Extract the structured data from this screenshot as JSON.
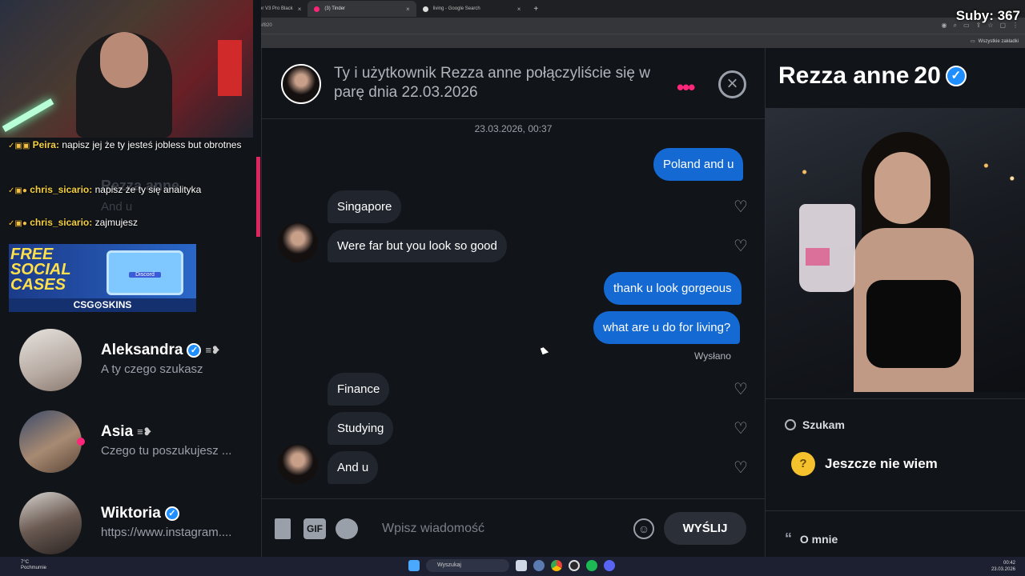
{
  "browser": {
    "tabs": [
      {
        "label": "er V3 Pro Black",
        "active": false
      },
      {
        "label": "(3) Tinder",
        "active": true
      },
      {
        "label": "living - Google Search",
        "active": false
      }
    ],
    "url_fragment": "17ef820",
    "bookmarks_label": "Wszystkie zakładki"
  },
  "overlay": {
    "subs": "Suby: 367"
  },
  "stream_chat": [
    {
      "nick": "Peira:",
      "text": "napisz jej że ty jesteś jobless but obrotnes"
    },
    {
      "nick": "chris_sicario:",
      "text": "napisz że ty się analityka"
    },
    {
      "nick": "chris_sicario:",
      "text": "zajmujesz"
    }
  ],
  "ghost_text": {
    "name": "Rezza anne",
    "msg": "And u"
  },
  "promo": {
    "headline_line1": "FREE",
    "headline_line2": "SOCIAL",
    "headline_line3": "CASES",
    "case_label": "Discord",
    "brand": "CSG⊙SKINS"
  },
  "matches": [
    {
      "name": "Aleksandra",
      "verified": true,
      "message": "A ty czego szukasz",
      "unread": false
    },
    {
      "name": "Asia",
      "verified": false,
      "message": "Czego tu poszukujesz ...",
      "unread": true
    },
    {
      "name": "Wiktoria",
      "verified": true,
      "message": "https://www.instagram....",
      "unread": false
    }
  ],
  "conversation": {
    "header": "Ty i użytkownik Rezza anne połączyliście się w parę dnia 22.03.2026",
    "timestamp": "23.03.2026, 00:37",
    "messages": [
      {
        "dir": "out",
        "text": "Poland and u"
      },
      {
        "dir": "in",
        "text": "Singapore"
      },
      {
        "dir": "in",
        "text": "Were far but you look so good"
      },
      {
        "dir": "out",
        "text": "thank u look gorgeous"
      },
      {
        "dir": "out",
        "text": "what are u do for living?"
      },
      {
        "dir": "in",
        "text": "Finance"
      },
      {
        "dir": "in",
        "text": "Studying"
      },
      {
        "dir": "in",
        "text": "And u"
      }
    ],
    "sent_label": "Wysłano",
    "composer": {
      "gif_label": "GIF",
      "placeholder": "Wpisz wiadomość",
      "send_label": "WYŚLIJ"
    }
  },
  "profile": {
    "name": "Rezza anne",
    "age": "20",
    "verified": true,
    "looking_for_label": "Szukam",
    "looking_for_value": "Jeszcze nie wiem",
    "about_label": "O mnie"
  },
  "taskbar": {
    "weather_temp": "7°C",
    "weather_desc": "Pochmurnie",
    "search_placeholder": "Wyszukaj",
    "time": "00:42",
    "date": "23.03.2026"
  },
  "colors": {
    "tinder_pink": "#fd267a",
    "bubble_out": "#1469d2",
    "bubble_in": "#21262e",
    "verified_blue": "#1f8fff"
  }
}
